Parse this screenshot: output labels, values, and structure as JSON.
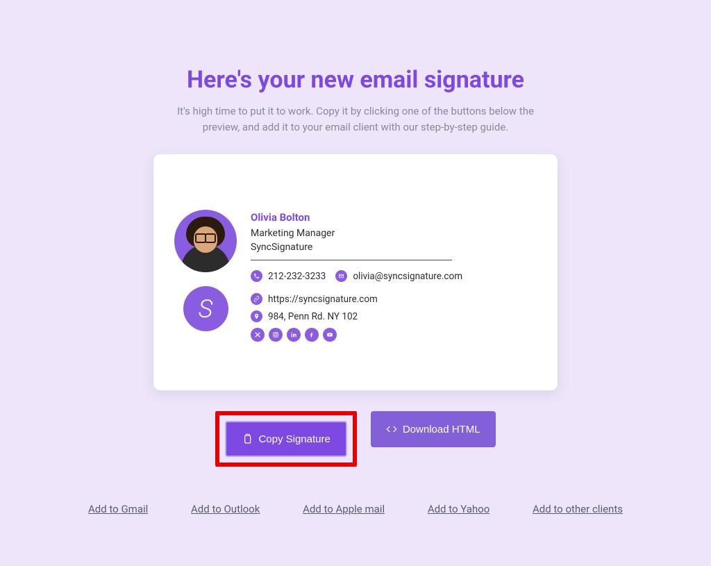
{
  "header": {
    "title": "Here's your new email signature",
    "subtitle": "It's high time to put it to work. Copy it by clicking one of the buttons below the preview, and add it to your email client with our step-by-step guide."
  },
  "signature": {
    "name": "Olivia Bolton",
    "job_title": "Marketing Manager",
    "company": "SyncSignature",
    "phone": "212-232-3233",
    "email": "olivia@syncsignature.com",
    "website": "https://syncsignature.com",
    "address": "984, Penn Rd. NY 102"
  },
  "socials": [
    "x",
    "instagram",
    "linkedin",
    "facebook",
    "youtube"
  ],
  "buttons": {
    "copy": "Copy Signature",
    "download": "Download HTML"
  },
  "links": [
    "Add to Gmail",
    "Add to Outlook",
    "Add to Apple mail",
    "Add to Yahoo",
    "Add to other clients"
  ],
  "colors": {
    "accent": "#7c49e3",
    "highlight": "#e80000"
  }
}
